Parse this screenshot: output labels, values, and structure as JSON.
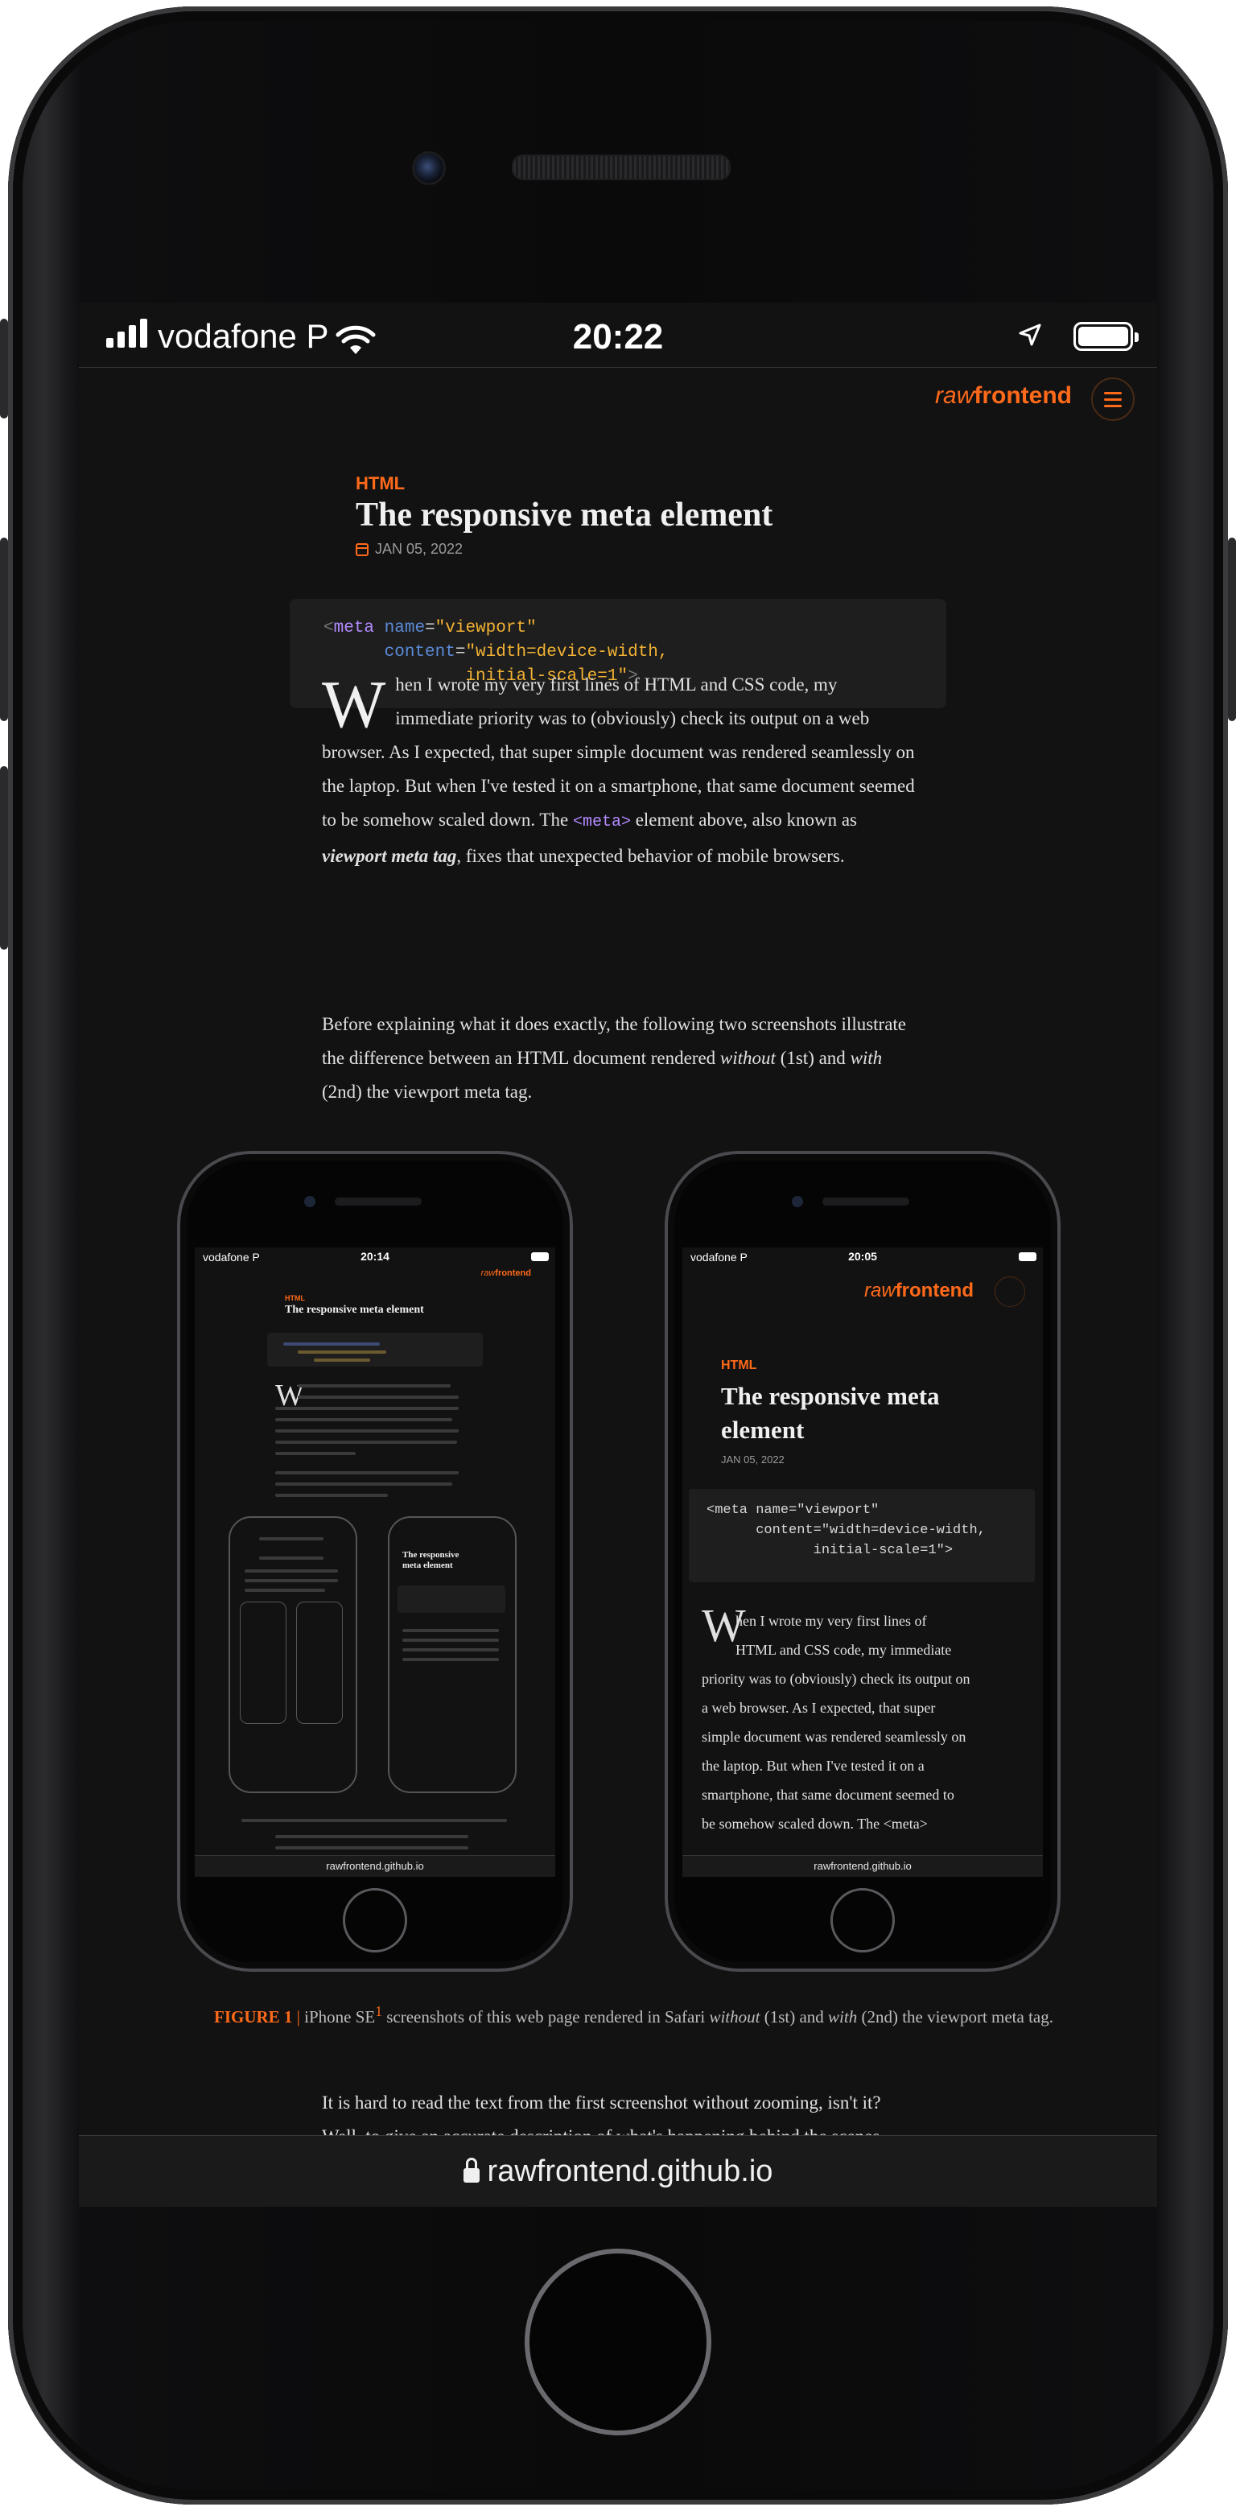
{
  "status_bar": {
    "carrier": "vodafone P",
    "time": "20:22",
    "battery_level": 1.0
  },
  "site": {
    "logo_raw": "raw",
    "logo_frontend": "frontend",
    "accent_color": "#ff6a1a"
  },
  "article": {
    "category": "HTML",
    "title": "The responsive meta element",
    "date": "JAN 05, 2022",
    "code": {
      "line1_tag": "meta",
      "line1_attr": "name",
      "line1_value": "\"viewport\"",
      "line2_attr": "content",
      "line2_value": "\"width=device-width,",
      "line3_value": "initial-scale=1\""
    },
    "para1_dropcap": "W",
    "para1_a": "hen I wrote my very first lines of HTML and CSS code, my immediate priority was to (obviously) check its output on a web browser. As I expected, that super simple document was rendered seamlessly on the laptop. But when I've tested it on a smartphone, that same document seemed to be somehow scaled down. The ",
    "para1_code": "<meta>",
    "para1_b": " element above, also known as ",
    "para1_strong": "viewport meta tag",
    "para1_c": ", fixes that unexpected behavior of mobile browsers.",
    "para2_a": "Before explaining what it does exactly, the following two screenshots illustrate the difference between an HTML document rendered ",
    "para2_em1": "without",
    "para2_b": " (1st) and ",
    "para2_em2": "with",
    "para2_c": " (2nd) the viewport meta tag.",
    "figure": {
      "phone1": {
        "carrier": "vodafone P",
        "time": "20:14",
        "url": "rawfrontend.github.io",
        "category": "HTML",
        "title": "The responsive meta element"
      },
      "phone2": {
        "carrier": "vodafone P",
        "time": "20:05",
        "url": "rawfrontend.github.io",
        "category": "HTML",
        "title_line1": "The responsive meta",
        "title_line2": "element",
        "date": "JAN 05, 2022",
        "code_line1": "<meta name=\"viewport\"",
        "code_line2": "content=\"width=device-width,",
        "code_line3": "initial-scale=1\">",
        "para_dropcap": "W",
        "para_lines": [
          "hen I wrote my very first lines of",
          "HTML and CSS code, my immediate",
          "priority was to (obviously) check its output on",
          "a web browser. As I expected, that super",
          "simple document was rendered seamlessly on",
          "the laptop. But when I've tested it on a",
          "smartphone, that same document seemed to",
          "be somehow scaled down. The <meta>"
        ]
      },
      "caption_label": "FIGURE 1",
      "caption_sep": "|",
      "caption_a": "iPhone SE",
      "caption_sup": "1",
      "caption_b": " screenshots of this web page rendered in Safari ",
      "caption_em1": "without",
      "caption_c": " (1st) and ",
      "caption_em2": "with",
      "caption_d": " (2nd) the viewport meta tag."
    },
    "para3_line1": "It is hard to read the text from the first screenshot without zooming, isn't it?",
    "para3_line2": "Well, to give an accurate description of what's happening behind the scenes,"
  },
  "url_bar": {
    "url": "rawfrontend.github.io"
  }
}
